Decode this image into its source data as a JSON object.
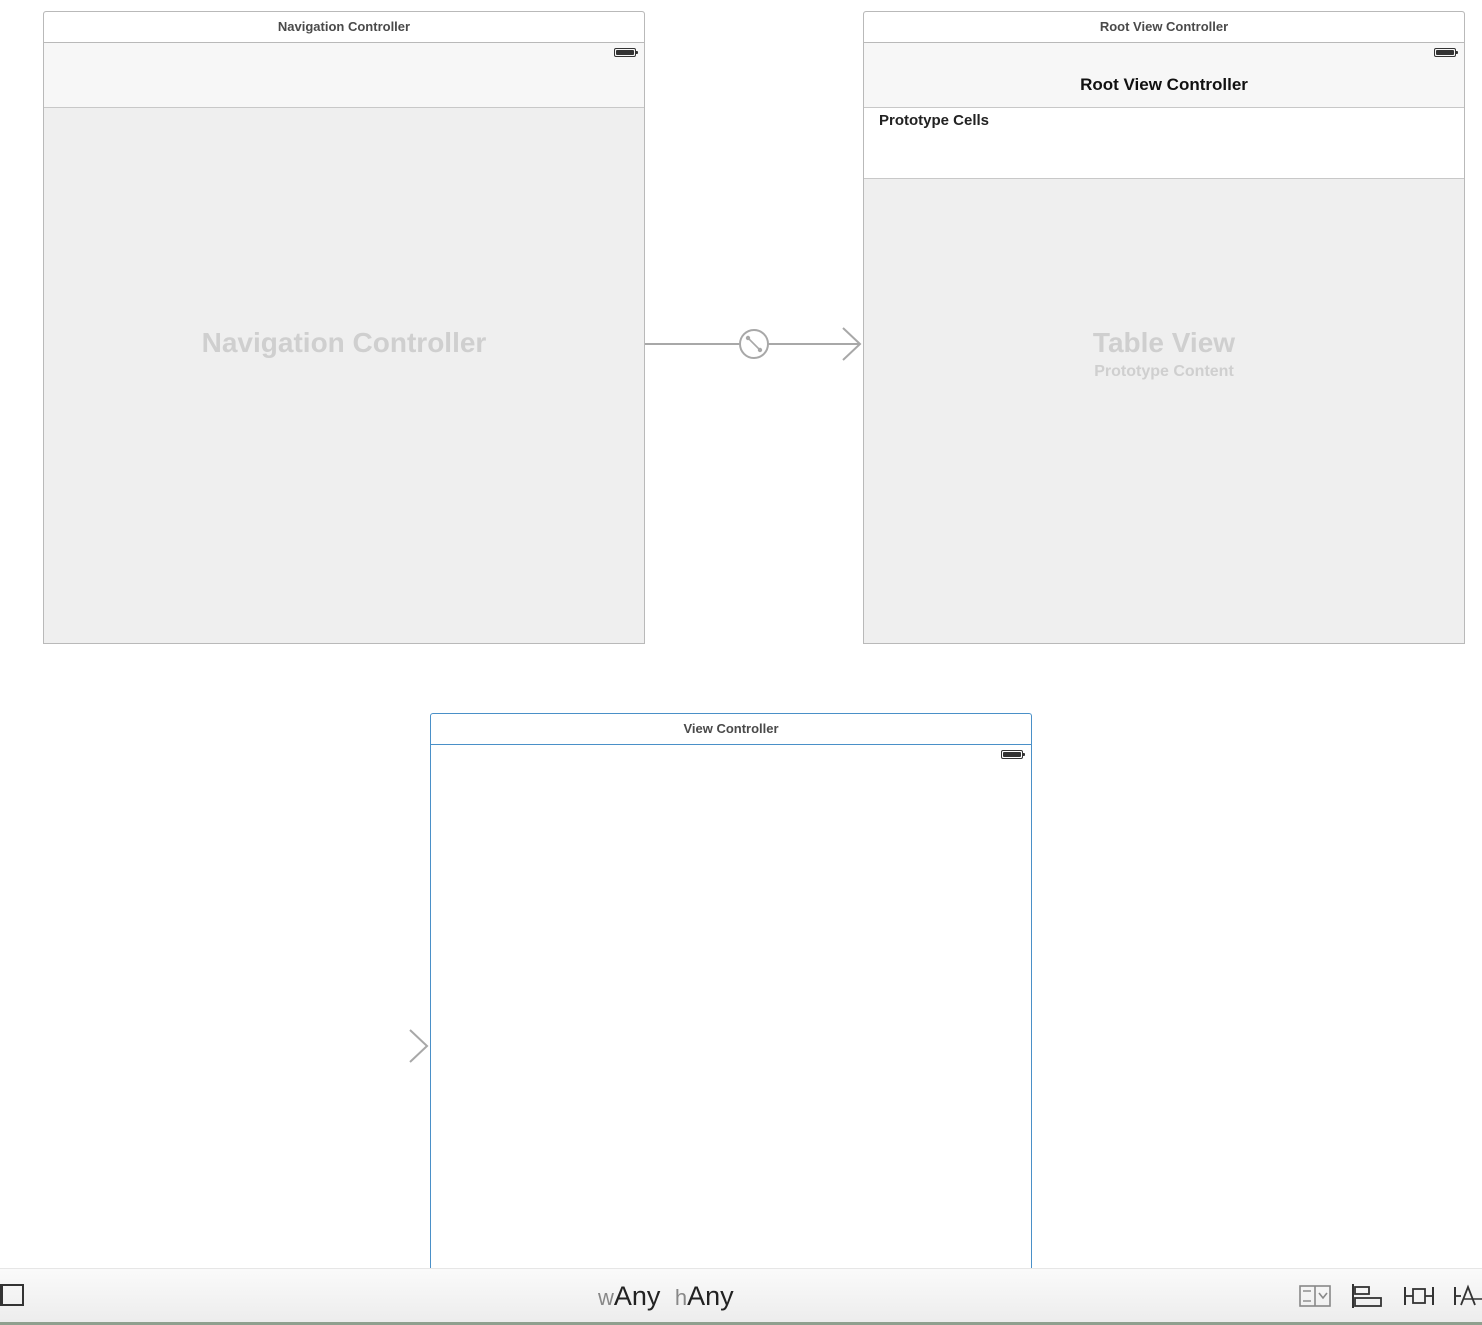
{
  "scenes": {
    "navigation_controller": {
      "title": "Navigation Controller",
      "placeholder": "Navigation Controller"
    },
    "root_view_controller": {
      "title": "Root View Controller",
      "nav_title": "Root View Controller",
      "prototype_cells_label": "Prototype Cells",
      "table_placeholder": "Table View",
      "table_subtitle": "Prototype Content"
    },
    "view_controller": {
      "title": "View Controller"
    }
  },
  "bottom_bar": {
    "width_prefix": "w",
    "width_value": "Any",
    "height_prefix": "h",
    "height_value": "Any",
    "tools": [
      "embed-in-stack-icon",
      "align-icon",
      "pin-icon",
      "resolve-auto-layout-icon"
    ]
  },
  "colors": {
    "canvas": "#ffffff",
    "scene_background": "#efefef",
    "selection": "#4a90c8",
    "segue": "#a8a8a8"
  }
}
